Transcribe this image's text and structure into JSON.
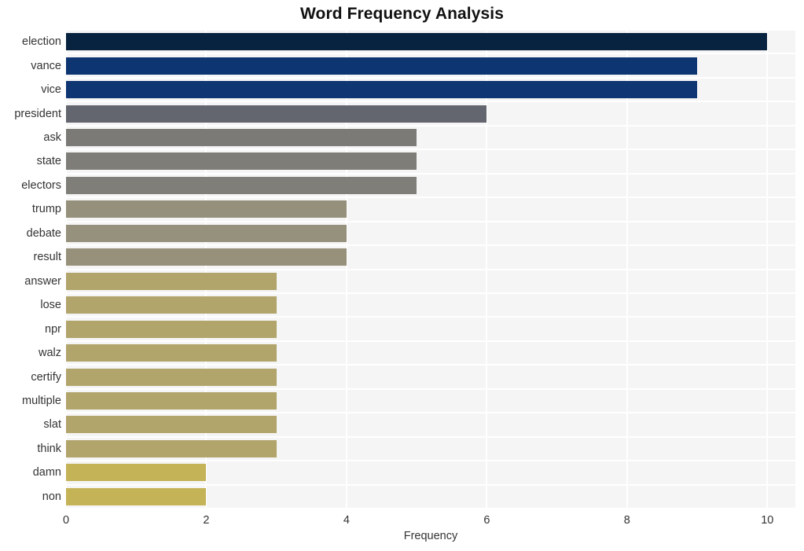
{
  "chart_data": {
    "type": "bar",
    "orientation": "horizontal",
    "title": "Word Frequency Analysis",
    "xlabel": "Frequency",
    "ylabel": "",
    "xlim": [
      0,
      10.4
    ],
    "ylim": [
      0,
      20
    ],
    "grid": true,
    "legend": null,
    "xticks": [
      "0",
      "2",
      "4",
      "6",
      "8",
      "10"
    ],
    "xtick_values": [
      0,
      2,
      4,
      6,
      8,
      10
    ],
    "categories": [
      "election",
      "vance",
      "vice",
      "president",
      "ask",
      "state",
      "electors",
      "trump",
      "debate",
      "result",
      "answer",
      "lose",
      "npr",
      "walz",
      "certify",
      "multiple",
      "slat",
      "think",
      "damn",
      "non"
    ],
    "values": [
      10,
      9,
      9,
      6,
      5,
      5,
      5,
      4,
      4,
      4,
      3,
      3,
      3,
      3,
      3,
      3,
      3,
      3,
      2,
      2
    ],
    "bar_colors": [
      "#08233f",
      "#0d3571",
      "#0f3672",
      "#63666e",
      "#7b7a77",
      "#7e7d78",
      "#7f7e79",
      "#95907c",
      "#96917c",
      "#97917c",
      "#b1a56c",
      "#b1a56c",
      "#b1a56c",
      "#b1a56c",
      "#b1a56c",
      "#b1a56c",
      "#b1a56c",
      "#b1a56c",
      "#c5b358",
      "#c5b358"
    ],
    "plot_background": "#f5f5f5",
    "gridline_color": "#ffffff",
    "figure_background": "#ffffff"
  }
}
